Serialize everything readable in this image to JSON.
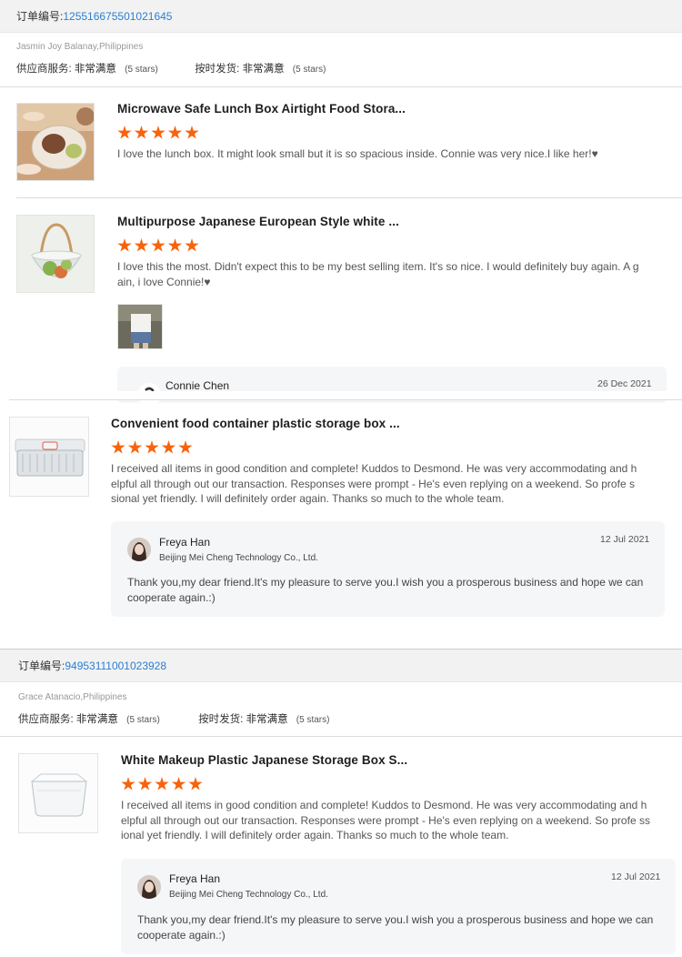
{
  "orders": [
    {
      "order_label": "订单编号:",
      "order_number": "125516675501021645",
      "buyer": "Jasmin Joy Balanay,Philippines",
      "service_label": "供应商服务:",
      "service_value": "非常满意",
      "service_stars": "(5 stars)",
      "shipping_label": "按时发货:",
      "shipping_value": "非常满意",
      "shipping_stars": "(5 stars)"
    },
    {
      "order_label": "订单编号:",
      "order_number": "94953111001023928",
      "buyer": "Grace Atanacio,Philippines",
      "service_label": "供应商服务:",
      "service_value": "非常满意",
      "service_stars": "(5 stars)",
      "shipping_label": "按时发货:",
      "shipping_value": "非常满意",
      "shipping_stars": "(5 stars)"
    }
  ],
  "items": [
    {
      "title": "Microwave Safe Lunch Box Airtight Food Stora...",
      "rating": 5,
      "review": "I love the lunch box. It might look small but it is so spacious inside. Connie was very nice.I like her!♥"
    },
    {
      "title": "Multipurpose Japanese European Style white ...",
      "rating": 5,
      "review": "I love this the most. Didn't expect this to be my best selling item. It's so nice. I would definitely buy again. A gain, i love Connie!♥",
      "reply_name": "Connie Chen",
      "reply_date": "26 Dec 2021"
    },
    {
      "title": "Convenient food container plastic storage box ...",
      "rating": 5,
      "review": "I received all items in good condition and complete! Kuddos to Desmond. He was very accommodating and helpful all through out our transaction. Responses were prompt - He's even replying on a weekend. So profe ssional yet friendly. I will definitely order again. Thanks so much to the whole team.",
      "reply_name": "Freya Han",
      "reply_company": "Beijing Mei Cheng Technology Co., Ltd.",
      "reply_date": "12 Jul 2021",
      "reply_text": "Thank you,my dear friend.It's my pleasure to serve you.I wish you a prosperous business and hope we can cooperate again.:)"
    },
    {
      "title": "White Makeup Plastic Japanese Storage Box S...",
      "rating": 5,
      "review": "I received all items in good condition and complete! Kuddos to Desmond. He was very accommodating and helpful all through out our transaction. Responses were prompt - He's even replying on a weekend. So profe ssional yet friendly. I will definitely order again. Thanks so much to the whole team.",
      "reply_name": "Freya Han",
      "reply_company": "Beijing Mei Cheng Technology Co., Ltd.",
      "reply_date": "12 Jul 2021",
      "reply_text": "Thank you,my dear friend.It's my pleasure to serve you.I wish you a prosperous business and hope we can cooperate again.:)"
    }
  ],
  "colors": {
    "star": "#f7630c",
    "order_number": "#2a7fd1",
    "header_bg": "#f2f2f2",
    "reply_bg": "#f5f6f8"
  }
}
